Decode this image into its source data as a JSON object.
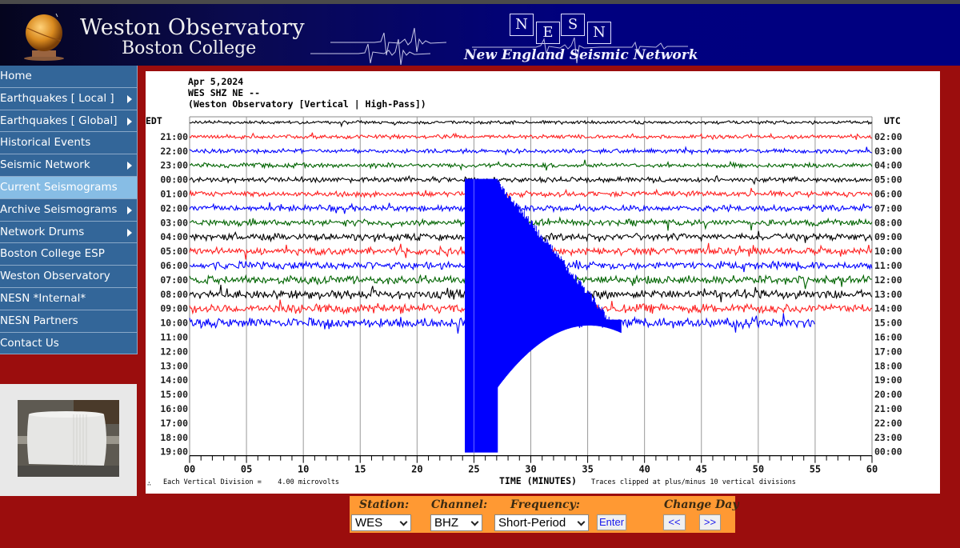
{
  "header": {
    "title_line1": "Weston Observatory",
    "title_line2": "Boston College",
    "nesn_letters": [
      "N",
      "E",
      "S",
      "N"
    ],
    "nesn_subtitle": "New England Seismic Network"
  },
  "sidebar": {
    "items": [
      {
        "label": "Home",
        "has_submenu": false,
        "active": false
      },
      {
        "label": "Earthquakes [ Local ]",
        "has_submenu": true,
        "active": false
      },
      {
        "label": "Earthquakes [ Global]",
        "has_submenu": true,
        "active": false
      },
      {
        "label": "Historical Events",
        "has_submenu": false,
        "active": false
      },
      {
        "label": "Seismic Network",
        "has_submenu": true,
        "active": false
      },
      {
        "label": "Current Seismograms",
        "has_submenu": false,
        "active": true
      },
      {
        "label": "Archive Seismograms",
        "has_submenu": true,
        "active": false
      },
      {
        "label": "Network Drums",
        "has_submenu": true,
        "active": false
      },
      {
        "label": "Boston College ESP",
        "has_submenu": false,
        "active": false
      },
      {
        "label": "Weston Observatory",
        "has_submenu": false,
        "active": false
      },
      {
        "label": "NESN *Internal*",
        "has_submenu": false,
        "active": false
      },
      {
        "label": "NESN Partners",
        "has_submenu": false,
        "active": false
      },
      {
        "label": "Contact Us",
        "has_submenu": false,
        "active": false
      }
    ],
    "drum_photo_alt": "seismograph drum"
  },
  "seismogram": {
    "date": "Apr 5,2024",
    "station_line": "WES SHZ NE --",
    "description": "(Weston Observatory [Vertical | High-Pass])",
    "left_tz": "EDT",
    "right_tz": "UTC",
    "footer_scale": "Each Vertical Division =    4.00 microvolts",
    "footer_axis": "TIME (MINUTES)",
    "footer_clip": "Traces clipped at plus/minus 10 vertical divisions",
    "corner_mark": "∴"
  },
  "chart_data": {
    "type": "line",
    "title": "Apr 5,2024 — WES SHZ NE -- (Weston Observatory [Vertical | High-Pass])",
    "xlabel": "TIME (MINUTES)",
    "ylabel_left": "EDT",
    "ylabel_right": "UTC",
    "xlim": [
      0,
      60
    ],
    "x_ticks": [
      "00",
      "05",
      "10",
      "15",
      "20",
      "25",
      "30",
      "35",
      "40",
      "45",
      "50",
      "55",
      "60"
    ],
    "left_labels": [
      "",
      "21:00",
      "22:00",
      "23:00",
      "00:00",
      "01:00",
      "02:00",
      "03:00",
      "04:00",
      "05:00",
      "06:00",
      "07:00",
      "08:00",
      "09:00",
      "10:00",
      "11:00",
      "12:00",
      "13:00",
      "14:00",
      "15:00",
      "16:00",
      "17:00",
      "18:00",
      "19:00"
    ],
    "right_labels": [
      "",
      "02:00",
      "03:00",
      "04:00",
      "05:00",
      "06:00",
      "07:00",
      "08:00",
      "09:00",
      "10:00",
      "11:00",
      "12:00",
      "13:00",
      "14:00",
      "15:00",
      "16:00",
      "17:00",
      "18:00",
      "19:00",
      "20:00",
      "21:00",
      "22:00",
      "23:00",
      "00:00"
    ],
    "trace_colors": [
      "#000000",
      "#ff2020",
      "#0000ff",
      "#006400"
    ],
    "recorded_hours": 15,
    "last_trace_end_minute": 55,
    "grid": true,
    "event": {
      "start_minute": 24.2,
      "clipped_until_minute": 27.1,
      "start_row": 4,
      "extends_to_bottom_row": 23,
      "coda_end_minute": 38,
      "color": "#0000ff"
    },
    "units": "Each Vertical Division = 4.00 microvolts",
    "clip_note": "Traces clipped at plus/minus 10 vertical divisions"
  },
  "controls": {
    "station_label": "Station:",
    "station_value": "WES",
    "channel_label": "Channel:",
    "channel_value": "BHZ",
    "frequency_label": "Frequency:",
    "frequency_value": "Short-Period",
    "enter_label": "Enter",
    "change_day_label": "Change Day",
    "prev_label": "<<",
    "next_label": ">>"
  },
  "colors": {
    "header_navy": "#000080",
    "page_red": "#9b0d0d",
    "nav_blue": "#336699",
    "nav_active": "#87bde5",
    "controls_orange": "#ff9933"
  }
}
